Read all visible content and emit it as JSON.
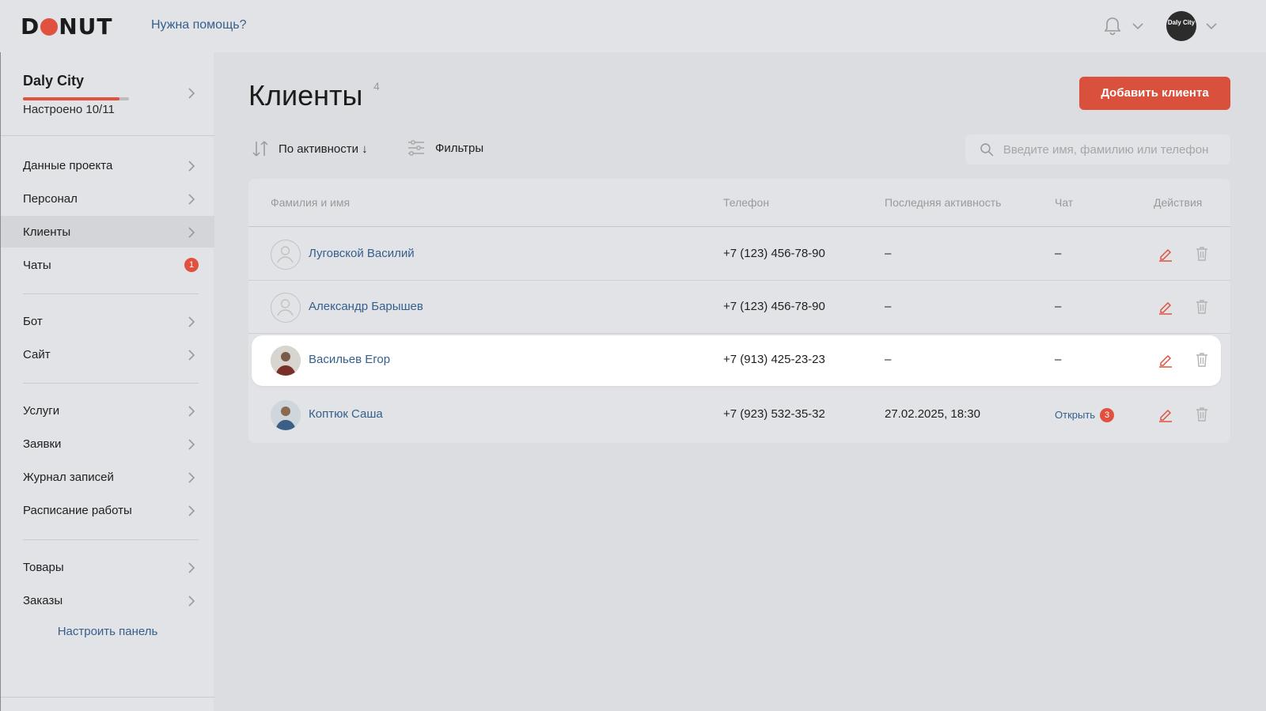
{
  "header": {
    "logo": "DONUT",
    "help_link": "Нужна помощь?",
    "avatar_text": "Daly City"
  },
  "sidebar": {
    "project": {
      "name": "Daly City",
      "status": "Настроено 10/11",
      "progress": 0.91
    },
    "items": [
      {
        "label": "Данные проекта"
      },
      {
        "label": "Персонал"
      },
      {
        "label": "Клиенты",
        "active": true
      },
      {
        "label": "Чаты",
        "badge": "1"
      },
      {
        "label": "Бот"
      },
      {
        "label": "Сайт"
      },
      {
        "label": "Услуги"
      },
      {
        "label": "Заявки"
      },
      {
        "label": "Журнал записей"
      },
      {
        "label": "Расписание работы"
      },
      {
        "label": "Товары"
      },
      {
        "label": "Заказы"
      }
    ],
    "customize_label": "Настроить панель"
  },
  "main": {
    "title": "Клиенты",
    "count": "4",
    "add_button": "Добавить клиента",
    "sort_label": "По активности ↓",
    "filters_label": "Фильтры",
    "search_placeholder": "Введите имя, фамилию или телефон"
  },
  "table": {
    "columns": [
      "Фамилия и имя",
      "Телефон",
      "Последняя активность",
      "Чат",
      "Действия"
    ],
    "rows": [
      {
        "name": "Луговской Василий",
        "phone": "+7 (123) 456-78-90",
        "activity": "–",
        "chat": "–"
      },
      {
        "name": "Александр Барышев",
        "phone": "+7 (123) 456-78-90",
        "activity": "–",
        "chat": "–"
      },
      {
        "name": "Васильев Егор",
        "phone": "+7 (913) 425-23-23",
        "activity": "–",
        "chat": "–"
      },
      {
        "name": "Коптюк Саша",
        "phone": "+7 (923) 532-35-32",
        "activity": "27.02.2025, 18:30",
        "chat": "Открыть",
        "chat_badge": "3"
      }
    ]
  },
  "colors": {
    "accent": "#d9503d",
    "link": "#35608d"
  }
}
